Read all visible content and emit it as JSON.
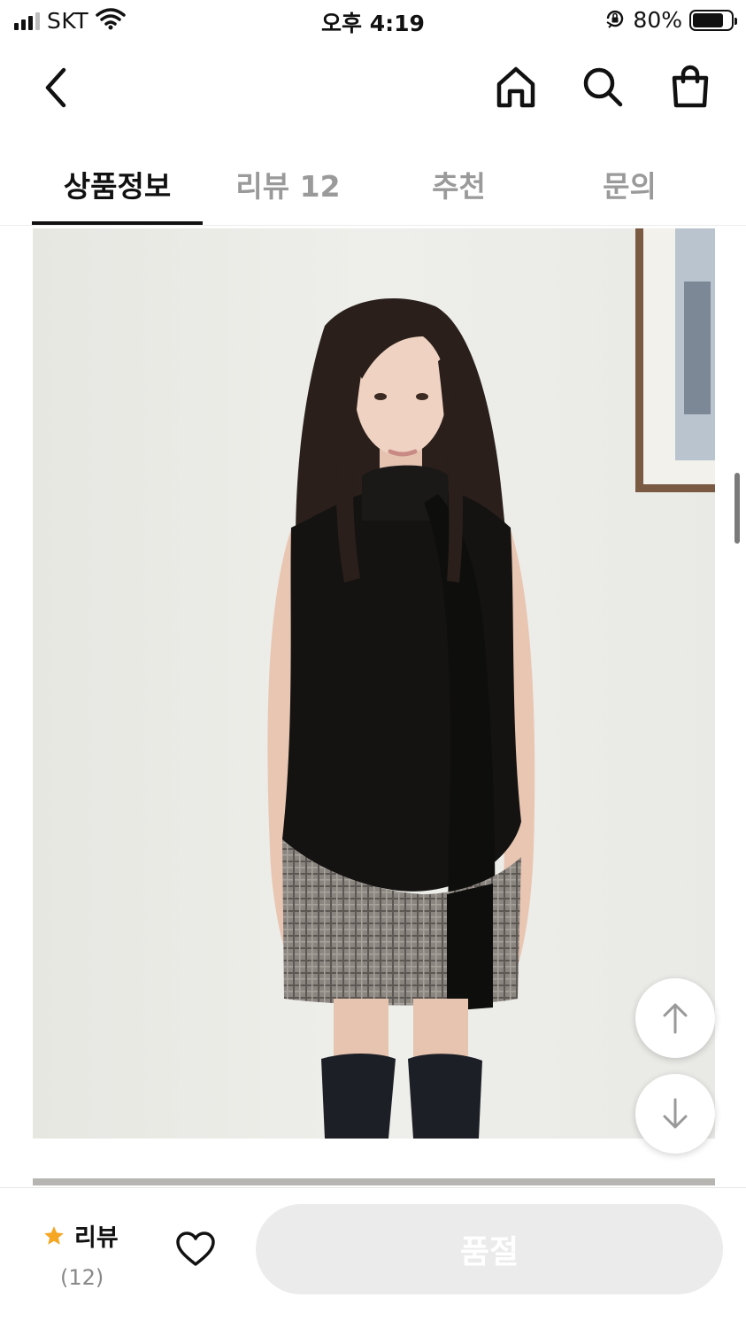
{
  "status_bar": {
    "carrier": "SKT",
    "time": "오후 4:19",
    "battery_percent": "80%",
    "battery_level": 0.8,
    "icons": [
      "signal-icon",
      "wifi-icon",
      "orientation-lock-icon",
      "battery-icon"
    ]
  },
  "nav": {
    "icons": [
      "back-arrow-icon",
      "home-icon",
      "search-icon",
      "shopping-bag-icon"
    ]
  },
  "tabs": [
    {
      "label": "상품정보",
      "active": true
    },
    {
      "label": "리뷰 12",
      "active": false
    },
    {
      "label": "추천",
      "active": false
    },
    {
      "label": "문의",
      "active": false
    }
  ],
  "product": {
    "image_subject": "model wearing black sleeveless knit top with scarf tie, plaid pleated skirt and black knee socks"
  },
  "floating_buttons": {
    "icons": [
      "arrow-up-icon",
      "arrow-down-icon"
    ]
  },
  "bottom_bar": {
    "review_label": "리뷰",
    "review_count": "(12)",
    "star_color": "#f5a623",
    "wish_icon": "heart-outline-icon",
    "soldout_label": "품절",
    "soldout_bg": "#ebebeb"
  }
}
